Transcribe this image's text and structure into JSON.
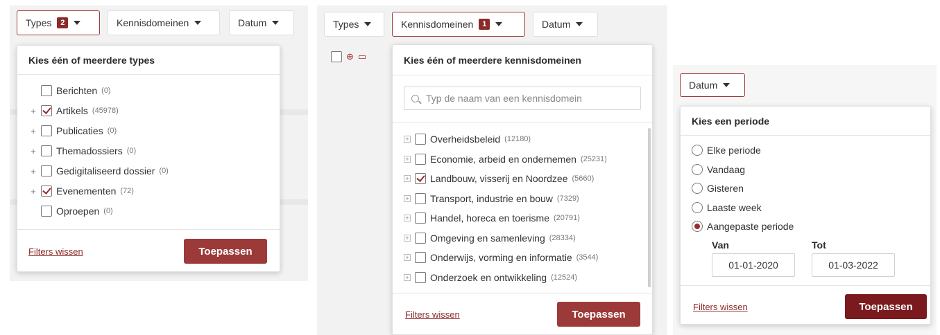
{
  "panel1": {
    "filters": {
      "types": "Types",
      "types_badge": "2",
      "kennisdomeinen": "Kennisdomeinen",
      "datum": "Datum"
    },
    "title": "Kies één of meerdere types",
    "items": [
      {
        "label": "Berichten",
        "count": "(0)",
        "checked": false,
        "expandable": false
      },
      {
        "label": "Artikels",
        "count": "(45978)",
        "checked": true,
        "expandable": true
      },
      {
        "label": "Publicaties",
        "count": "(0)",
        "checked": false,
        "expandable": true
      },
      {
        "label": "Themadossiers",
        "count": "(0)",
        "checked": false,
        "expandable": true
      },
      {
        "label": "Gedigitaliseerd dossier",
        "count": "(0)",
        "checked": false,
        "expandable": true
      },
      {
        "label": "Evenementen",
        "count": "(72)",
        "checked": true,
        "expandable": true
      },
      {
        "label": "Oproepen",
        "count": "(0)",
        "checked": false,
        "expandable": false
      }
    ],
    "clear_label": "Filters wissen",
    "apply_label": "Toepassen"
  },
  "panel2": {
    "filters": {
      "types": "Types",
      "kennisdomeinen": "Kennisdomeinen",
      "kennis_badge": "1",
      "datum": "Datum"
    },
    "title": "Kies één of meerdere kennisdomeinen",
    "search_placeholder": "Typ de naam van een kennisdomein",
    "items": [
      {
        "label": "Overheidsbeleid",
        "count": "(12180)",
        "checked": false
      },
      {
        "label": "Economie, arbeid en ondernemen",
        "count": "(25231)",
        "checked": false
      },
      {
        "label": "Landbouw, visserij en Noordzee",
        "count": "(5660)",
        "checked": true
      },
      {
        "label": "Transport, industrie en bouw",
        "count": "(7329)",
        "checked": false
      },
      {
        "label": "Handel, horeca en toerisme",
        "count": "(20791)",
        "checked": false
      },
      {
        "label": "Omgeving en samenleving",
        "count": "(28334)",
        "checked": false
      },
      {
        "label": "Onderwijs, vorming en informatie",
        "count": "(3544)",
        "checked": false
      },
      {
        "label": "Onderzoek en ontwikkeling",
        "count": "(12524)",
        "checked": false
      }
    ],
    "clear_label": "Filters wissen",
    "apply_label": "Toepassen"
  },
  "panel3": {
    "filters": {
      "datum": "Datum"
    },
    "title": "Kies een periode",
    "options": [
      {
        "label": "Elke periode",
        "selected": false
      },
      {
        "label": "Vandaag",
        "selected": false
      },
      {
        "label": "Gisteren",
        "selected": false
      },
      {
        "label": "Laaste week",
        "selected": false
      },
      {
        "label": "Aangepaste periode",
        "selected": true
      }
    ],
    "van_label": "Van",
    "tot_label": "Tot",
    "van_value": "01-01-2020",
    "tot_value": "01-03-2022",
    "clear_label": "Filters wissen",
    "apply_label": "Toepassen"
  },
  "colors": {
    "accent": "#9c3a3a",
    "accent_dark": "#7a1a1f",
    "badge": "#8c2a2a"
  }
}
